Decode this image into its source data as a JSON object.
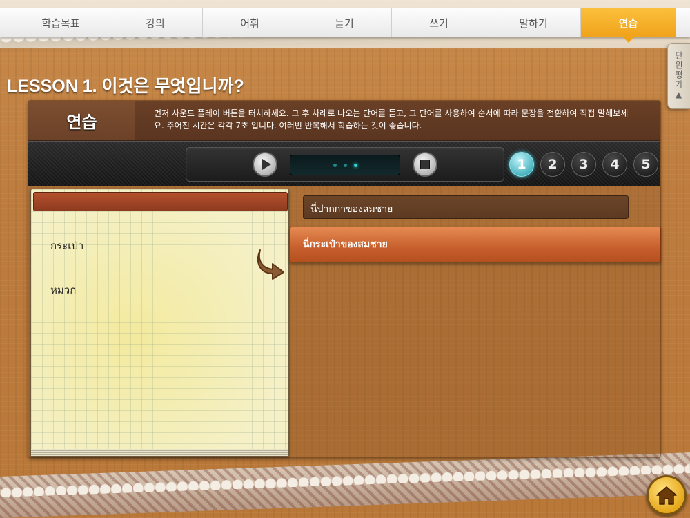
{
  "nav": {
    "tabs": [
      {
        "label": "학습목표"
      },
      {
        "label": "강의"
      },
      {
        "label": "어휘"
      },
      {
        "label": "듣기"
      },
      {
        "label": "쓰기"
      },
      {
        "label": "말하기"
      },
      {
        "label": "연습"
      }
    ],
    "active_index": 6
  },
  "side_tab": {
    "label": "단원평가▲"
  },
  "lesson": {
    "title": "LESSON 1. 이것은 무엇입니까?"
  },
  "instructions": {
    "label": "연습",
    "text": "먼저 사운드 플레이 버튼을 터치하세요. 그 후 차례로 나오는 단어를 듣고, 그 단어를 사용하여 순서에 따라 문장을 전환하여 직접 말해보세요. 주어진 시간은 각각 7초 입니다. 여러번 반복해서 학습하는 것이 좋습니다."
  },
  "player": {
    "play_icon": "play-icon",
    "stop_icon": "stop-icon",
    "accent_color": "#2bd3d8"
  },
  "steps": {
    "items": [
      "1",
      "2",
      "3",
      "4",
      "5"
    ],
    "active": 0
  },
  "notebook": {
    "words": [
      "กระเป๋า",
      "หมวก"
    ]
  },
  "sentences": {
    "model": "นี่ปากกาของสมชาย",
    "selected": "นี่กระเป๋าของสมชาย"
  },
  "home": {
    "icon": "home-icon"
  }
}
